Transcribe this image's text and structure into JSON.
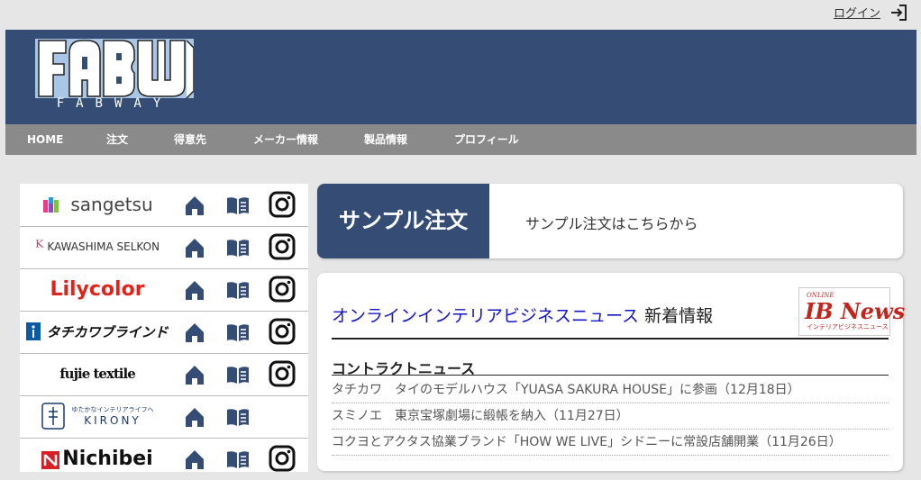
{
  "topbar": {
    "login_label": "ログイン"
  },
  "header": {
    "logo_text": "FABWAY"
  },
  "nav": {
    "items": [
      "HOME",
      "注文",
      "得意先",
      "メーカー情報",
      "製品情報",
      "プロフィール"
    ]
  },
  "sidebar": {
    "brands": [
      {
        "name": "sangetsu"
      },
      {
        "name": "KAWASHIMA SELKON"
      },
      {
        "name": "Lilycolor"
      },
      {
        "name": "タチカワブラインド"
      },
      {
        "name": "fujie textile"
      },
      {
        "name": "KIRONY",
        "tagline": "ゆたかなインテリアライフへ"
      },
      {
        "name": "Nichibei"
      }
    ]
  },
  "sample_panel": {
    "title": "サンプル注文",
    "description": "サンプル注文はこちらから"
  },
  "news": {
    "heading_link": "オンラインインテリアビジネスニュース",
    "heading_suffix": " 新着情報",
    "logo": {
      "text": "IB News",
      "small_top": "ONLINE",
      "small_bottom": "インテリアビジネスニュース"
    },
    "section_title": "コントラクトニュース",
    "items": [
      "タチカワ　タイのモデルハウス「YUASA SAKURA HOUSE」に参画（12月18日）",
      "スミノエ　東京宝塚劇場に緞帳を納入（11月27日）",
      "コクヨとアクタス協業ブランド「HOW WE LIVE」シドニーに常設店舗開業（11月26日）"
    ]
  },
  "colors": {
    "navy": "#354d74",
    "nav_gray": "#8a8a8a",
    "link_blue": "#1515c8"
  }
}
